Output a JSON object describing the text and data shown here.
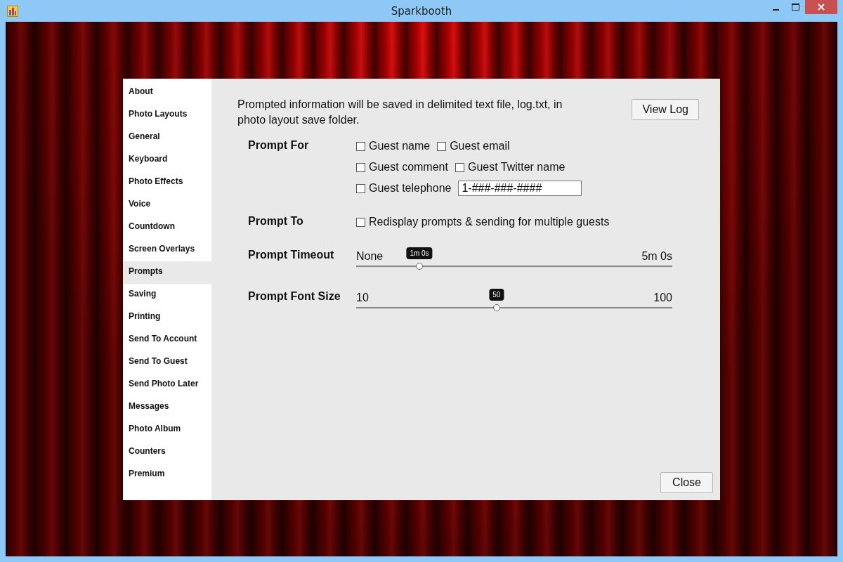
{
  "window": {
    "title": "Sparkbooth"
  },
  "sidebar": {
    "items": [
      {
        "label": "About",
        "selected": false
      },
      {
        "label": "Photo Layouts",
        "selected": false
      },
      {
        "label": "General",
        "selected": false
      },
      {
        "label": "Keyboard",
        "selected": false
      },
      {
        "label": "Photo Effects",
        "selected": false
      },
      {
        "label": "Voice",
        "selected": false
      },
      {
        "label": "Countdown",
        "selected": false
      },
      {
        "label": "Screen Overlays",
        "selected": false
      },
      {
        "label": "Prompts",
        "selected": true
      },
      {
        "label": "Saving",
        "selected": false
      },
      {
        "label": "Printing",
        "selected": false
      },
      {
        "label": "Send To Account",
        "selected": false
      },
      {
        "label": "Send To Guest",
        "selected": false
      },
      {
        "label": "Send Photo Later",
        "selected": false
      },
      {
        "label": "Messages",
        "selected": false
      },
      {
        "label": "Photo Album",
        "selected": false
      },
      {
        "label": "Counters",
        "selected": false
      },
      {
        "label": "Premium",
        "selected": false
      }
    ]
  },
  "description": "Prompted information will be saved in delimited text file, log.txt, in photo layout save folder.",
  "view_log_button": "View Log",
  "prompt_for": {
    "label": "Prompt For",
    "rows": [
      [
        {
          "label": "Guest name",
          "checked": false
        },
        {
          "label": "Guest email",
          "checked": false
        }
      ],
      [
        {
          "label": "Guest comment",
          "checked": false
        },
        {
          "label": "Guest Twitter name",
          "checked": false
        }
      ],
      [
        {
          "label": "Guest telephone",
          "checked": false,
          "value": "1-###-###-####"
        }
      ]
    ]
  },
  "prompt_to": {
    "label": "Prompt To",
    "option": {
      "label": "Redisplay prompts & sending for multiple guests",
      "checked": false
    }
  },
  "sliders": [
    {
      "label": "Prompt Timeout",
      "min": "None",
      "max": "5m 0s",
      "tooltip": "1m 0s",
      "level": 0.2
    },
    {
      "label": "Prompt Font Size",
      "min": "10",
      "max": "100",
      "tooltip": "50",
      "level": 0.444
    }
  ],
  "close_button": "Close"
}
